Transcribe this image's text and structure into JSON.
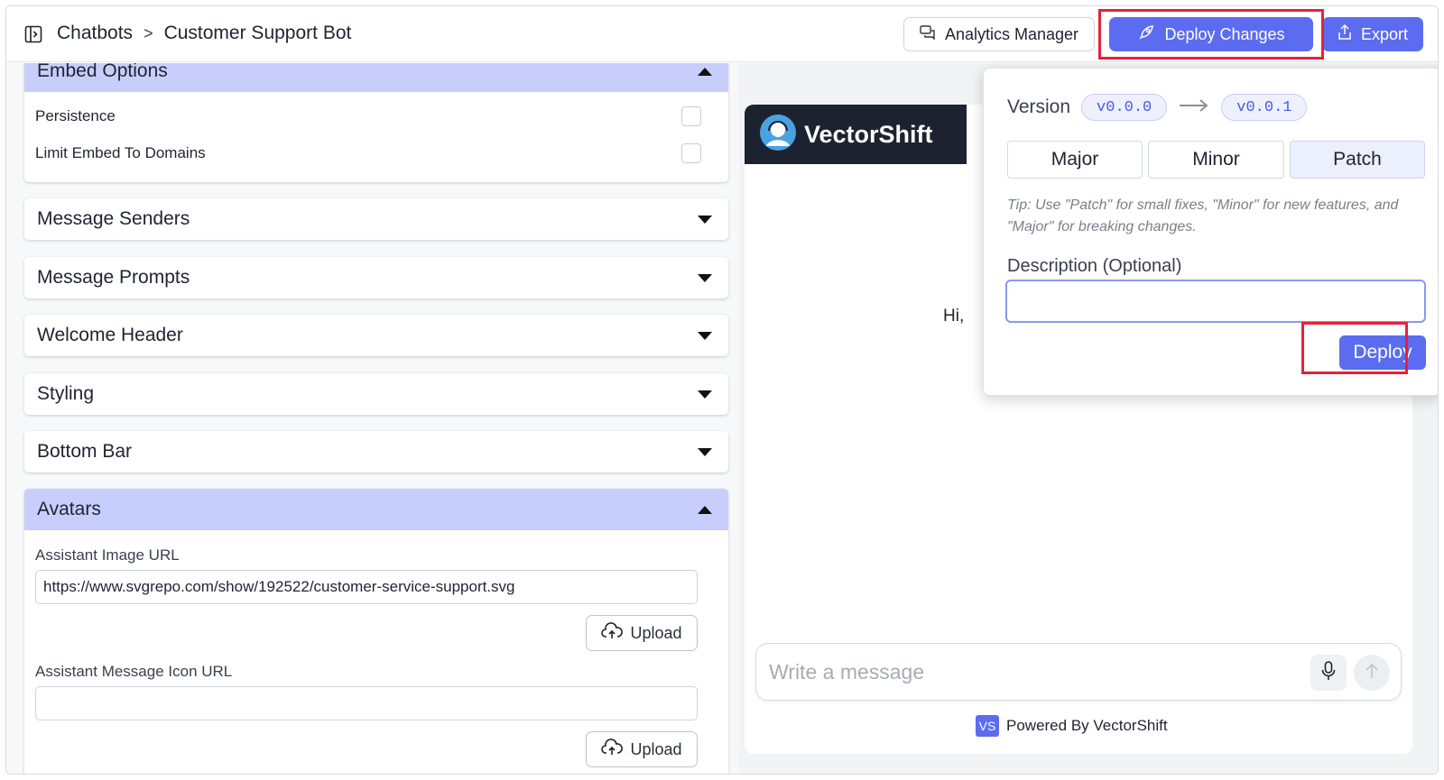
{
  "header": {
    "breadcrumb": [
      "Chatbots",
      "Customer Support Bot"
    ],
    "separator": ">",
    "analytics_label": "Analytics Manager",
    "deploy_changes_label": "Deploy Changes",
    "export_label": "Export"
  },
  "left": {
    "embed_options": {
      "title": "Embed Options",
      "rows": [
        {
          "label": "Persistence",
          "checked": false
        },
        {
          "label": "Limit Embed To Domains",
          "checked": false
        }
      ]
    },
    "sections": [
      "Message Senders",
      "Message Prompts",
      "Welcome Header",
      "Styling",
      "Bottom Bar"
    ],
    "avatars": {
      "title": "Avatars",
      "assistant_image_label": "Assistant Image URL",
      "assistant_image_value": "https://www.svgrepo.com/show/192522/customer-service-support.svg",
      "assistant_icon_label": "Assistant Message Icon URL",
      "assistant_icon_value": "",
      "upload_label": "Upload"
    }
  },
  "preview": {
    "brand": "VectorShift",
    "greeting": "Hi,",
    "composer_placeholder": "Write a message",
    "powered_badge": "VS",
    "powered_text": "Powered By VectorShift"
  },
  "popover": {
    "version_label": "Version",
    "from_version": "v0.0.0",
    "to_version": "v0.0.1",
    "options": [
      "Major",
      "Minor",
      "Patch"
    ],
    "selected": "Patch",
    "tip": "Tip: Use \"Patch\" for small fixes, \"Minor\" for new features, and \"Major\" for breaking changes.",
    "description_label": "Description (Optional)",
    "description_value": "",
    "deploy_label": "Deploy"
  },
  "colors": {
    "primary": "#5b6cf0",
    "highlight": "#e8203a",
    "accordion_open": "#c8cefb"
  }
}
